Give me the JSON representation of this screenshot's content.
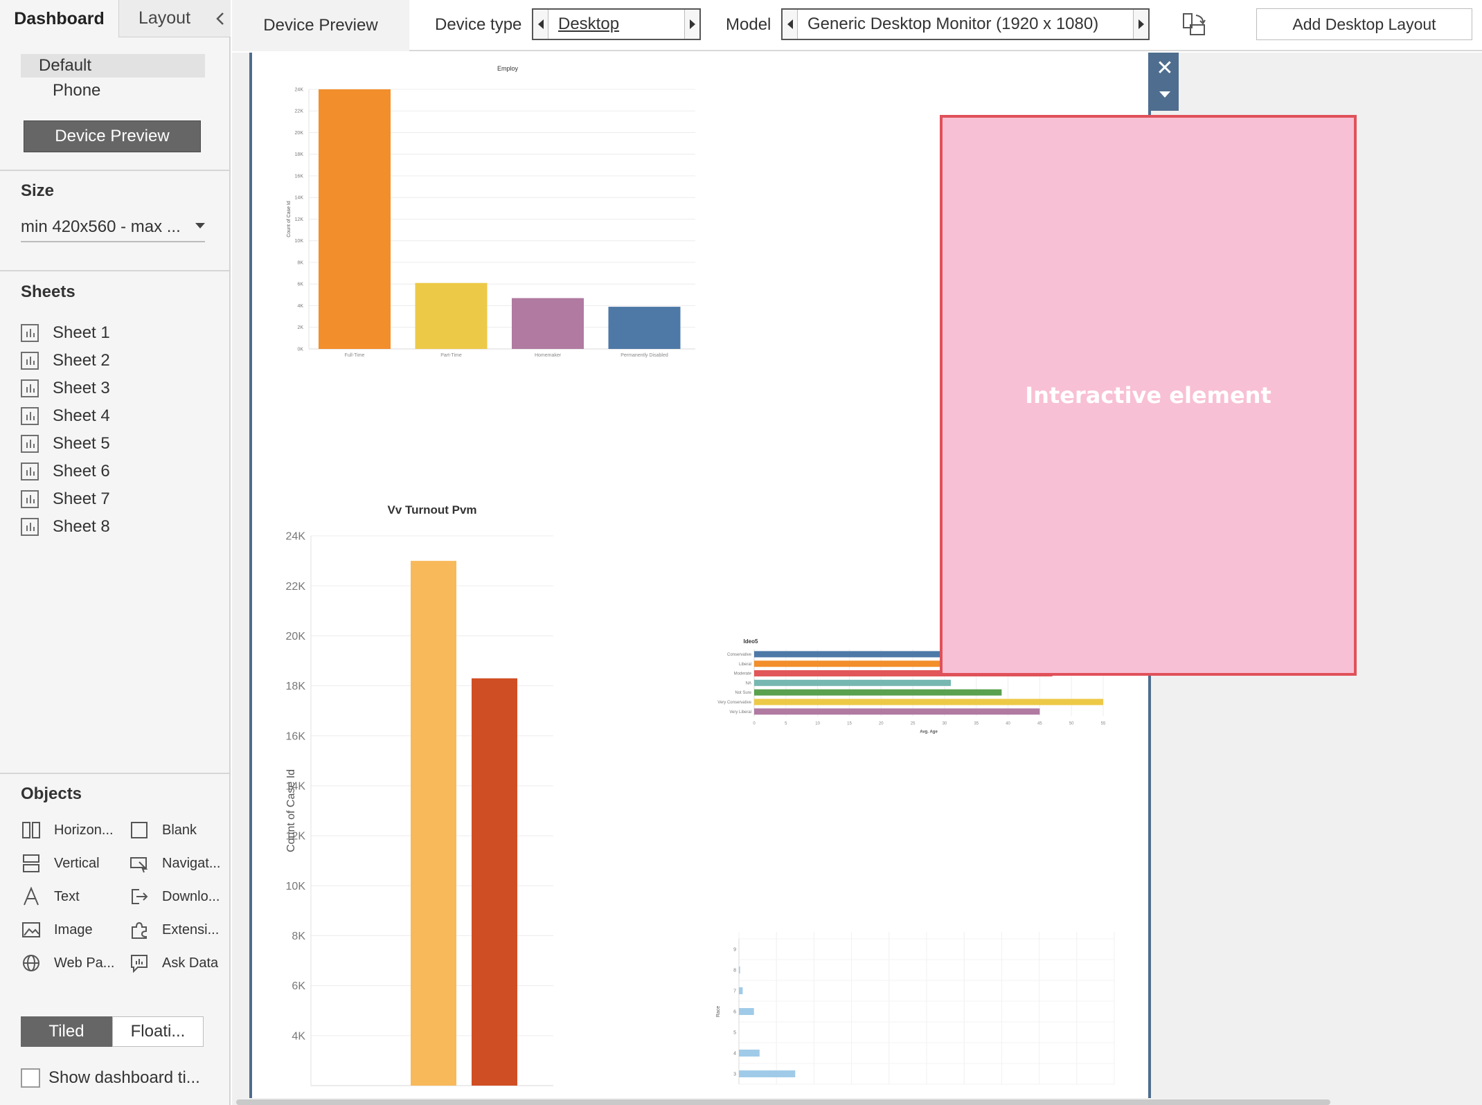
{
  "left_panel": {
    "tabs": {
      "dashboard": "Dashboard",
      "layout": "Layout"
    },
    "layouts": {
      "default": "Default",
      "phone": "Phone"
    },
    "device_preview_button": "Device Preview",
    "size": {
      "title": "Size",
      "value": "min 420x560 - max ..."
    },
    "sheets": {
      "title": "Sheets",
      "items": [
        "Sheet 1",
        "Sheet 2",
        "Sheet 3",
        "Sheet 4",
        "Sheet 5",
        "Sheet 6",
        "Sheet 7",
        "Sheet 8"
      ]
    },
    "objects": {
      "title": "Objects",
      "items": [
        {
          "label": "Horizon...",
          "icon": "horizontal-icon"
        },
        {
          "label": "Blank",
          "icon": "blank-icon"
        },
        {
          "label": "Vertical",
          "icon": "vertical-icon"
        },
        {
          "label": "Navigat...",
          "icon": "navigation-icon"
        },
        {
          "label": "Text",
          "icon": "text-icon"
        },
        {
          "label": "Downlo...",
          "icon": "download-icon"
        },
        {
          "label": "Image",
          "icon": "image-icon"
        },
        {
          "label": "Extensi...",
          "icon": "extension-icon"
        },
        {
          "label": "Web Pa...",
          "icon": "globe-icon"
        },
        {
          "label": "Ask Data",
          "icon": "ask-data-icon"
        }
      ]
    },
    "mode": {
      "tiled": "Tiled",
      "floating": "Floati..."
    },
    "show_title": "Show dashboard ti..."
  },
  "topbar": {
    "tab": "Device Preview",
    "device_type_label": "Device type",
    "device_type_value": "Desktop",
    "model_label": "Model",
    "model_value": "Generic Desktop Monitor (1920 x 1080)",
    "add_layout_button": "Add Desktop Layout"
  },
  "canvas": {
    "interactive_label": "Interactive element"
  },
  "chart_data": [
    {
      "type": "bar",
      "title": "Employ",
      "ylabel": "Count of Case Id",
      "categories": [
        "Full-Time",
        "Part-Time",
        "Homemaker",
        "Permanently Disabled"
      ],
      "values": [
        24000,
        6100,
        4700,
        3900
      ],
      "colors": [
        "#f28e2b",
        "#edc948",
        "#b07aa1",
        "#4e79a7"
      ],
      "yticks": [
        "0K",
        "2K",
        "4K",
        "6K",
        "8K",
        "10K",
        "12K",
        "14K",
        "16K",
        "18K",
        "20K",
        "22K",
        "24K"
      ],
      "ylim": [
        0,
        24000
      ],
      "grid": true
    },
    {
      "type": "bar",
      "title": "Vv Turnout Pvm",
      "ylabel": "Count of Case Id",
      "categories": [
        "",
        ""
      ],
      "values": [
        23000,
        18300
      ],
      "colors": [
        "#f7b95a",
        "#d04e23"
      ],
      "yticks": [
        "4K",
        "6K",
        "8K",
        "10K",
        "12K",
        "14K",
        "16K",
        "18K",
        "20K",
        "22K",
        "24K"
      ],
      "ylim": [
        2000,
        24000
      ],
      "grid": true
    },
    {
      "type": "bar",
      "orientation": "horizontal",
      "title": "Ideo5",
      "xlabel": "Avg. Age",
      "categories": [
        "Conservative",
        "Liberal",
        "Moderate",
        "NA",
        "Not Sure",
        "Very Conservative",
        "Very Liberal"
      ],
      "values": [
        53,
        46,
        47,
        31,
        39,
        55,
        45
      ],
      "colors": [
        "#4e79a7",
        "#f28e2b",
        "#e15759",
        "#76b7b2",
        "#59a14f",
        "#edc948",
        "#b07aa1"
      ],
      "xticks": [
        "0",
        "5",
        "10",
        "15",
        "20",
        "25",
        "30",
        "35",
        "40",
        "45",
        "50",
        "55"
      ],
      "xlim": [
        0,
        55
      ],
      "grid": true
    },
    {
      "type": "bar",
      "orientation": "horizontal",
      "ylabel": "Race",
      "categories": [
        "9",
        "8",
        "7",
        "6",
        "5",
        "4",
        "3"
      ],
      "values": [
        0,
        0.3,
        1,
        4,
        0,
        5.5,
        15
      ],
      "colors": [
        "#a0cbe8"
      ],
      "xlim": [
        0,
        100
      ],
      "grid": true
    }
  ]
}
